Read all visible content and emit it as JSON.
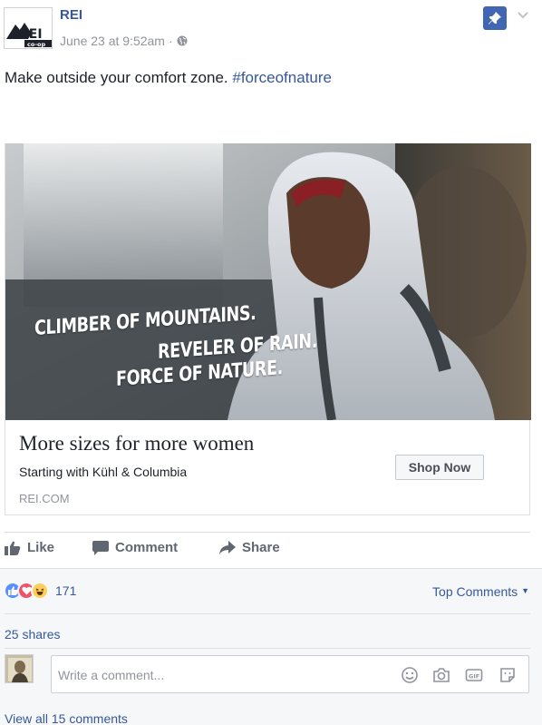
{
  "post": {
    "page_name": "REI",
    "logo_text": "REI co-op",
    "timestamp": "June 23 at 9:52am",
    "separator": "·",
    "audience_icon": "globe-icon",
    "text": "Make outside your comfort zone.",
    "hashtag": "#forceofnature"
  },
  "card": {
    "overlay_lines": [
      "CLIMBER OF MOUNTAINS.",
      "REVELER OF RAIN.",
      "FORCE OF NATURE."
    ],
    "title": "More sizes for more women",
    "description": "Starting with Kühl & Columbia",
    "domain": "REI.COM",
    "cta": "Shop Now"
  },
  "actions": {
    "like": "Like",
    "comment": "Comment",
    "share": "Share"
  },
  "engagement": {
    "reaction_icons": [
      "like-reaction-icon",
      "love-reaction-icon",
      "haha-reaction-icon"
    ],
    "reaction_count": "171",
    "sort_label": "Top Comments",
    "shares": "25 shares",
    "comment_placeholder": "Write a comment...",
    "view_all": "View all 15 comments"
  },
  "colors": {
    "link": "#365899",
    "pin_button": "#4267b2",
    "muted": "#90949c",
    "like_blue": "#5890ff",
    "love_red": "#f25268",
    "haha_yellow": "#fcd05b"
  }
}
